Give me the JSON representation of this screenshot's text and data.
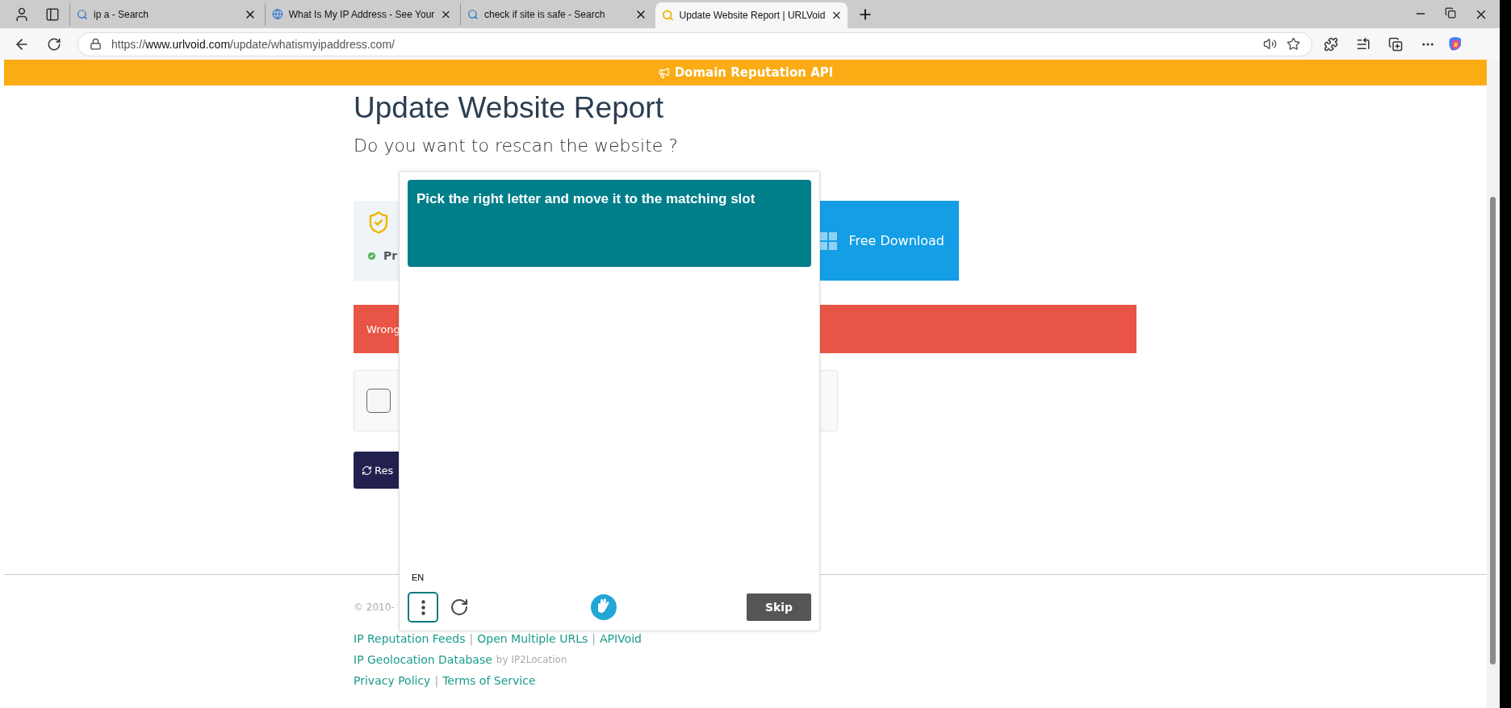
{
  "browser": {
    "tabs": [
      {
        "title": "ip a - Search",
        "kind": "search",
        "selected": false
      },
      {
        "title": "What Is My IP Address - See Your",
        "kind": "globe",
        "selected": false
      },
      {
        "title": "check if site is safe - Search",
        "kind": "search",
        "selected": false
      },
      {
        "title": "Update Website Report | URLVoid",
        "kind": "site",
        "selected": true
      }
    ],
    "url": {
      "scheme": "https://",
      "host": "www.urlvoid.com",
      "path": "/update/whatismyipaddress.com/"
    }
  },
  "banner": "Domain Reputation API",
  "page": {
    "title": "Update Website Report",
    "subtitle": "Do you want to rescan the website ?",
    "protection_text": "Pr",
    "download_button": "Free Download",
    "alert": "Wrong",
    "checkbox": {
      "checked": false
    },
    "rescan_button": "Res",
    "footer": {
      "copyright": "© 2010-",
      "links": [
        "IP Reputation Feeds",
        "Open Multiple URLs",
        "APIVoid"
      ],
      "separator": "|",
      "geo_link": "IP Geolocation Database",
      "geo_suffix": "by IP2Location",
      "legal": [
        "Privacy Policy",
        "Terms of Service"
      ]
    }
  },
  "captcha": {
    "prompt": "Pick the right letter and move it to the matching slot",
    "language": "EN",
    "skip_button": "Skip"
  }
}
